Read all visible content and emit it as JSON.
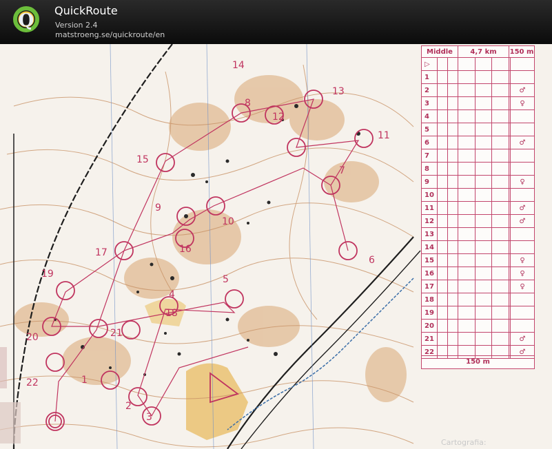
{
  "app": {
    "title": "QuickRoute",
    "version": "Version 2.4",
    "url": "matstroeng.se/quickroute/en",
    "logo_letter": "Q"
  },
  "colors": {
    "header_bg": "#111111",
    "course_magenta": "#c0345f",
    "paper": "#f7f3ee",
    "contour_brown": "#c08a60",
    "open_yellow": "#e8c270",
    "water_blue": "#3a6ea8"
  },
  "map": {
    "control_labels": [
      "14",
      "13",
      "8",
      "12",
      "15",
      "7",
      "9",
      "10",
      "16",
      "17",
      "11",
      "6",
      "19",
      "5",
      "18",
      "4",
      "20",
      "21",
      "22",
      "1",
      "2",
      "3"
    ],
    "credit": "Cartografia:"
  },
  "control_descriptions": {
    "header": {
      "event": "Middle",
      "length": "4,7 km",
      "climb": "150 m"
    },
    "rows": [
      {
        "num": "▷",
        "symbol": ""
      },
      {
        "num": "1",
        "symbol": ""
      },
      {
        "num": "2",
        "symbol": "♂"
      },
      {
        "num": "3",
        "symbol": "♀"
      },
      {
        "num": "4",
        "symbol": ""
      },
      {
        "num": "5",
        "symbol": ""
      },
      {
        "num": "6",
        "symbol": "♂"
      },
      {
        "num": "7",
        "symbol": ""
      },
      {
        "num": "8",
        "symbol": ""
      },
      {
        "num": "9",
        "symbol": "♀"
      },
      {
        "num": "10",
        "symbol": ""
      },
      {
        "num": "11",
        "symbol": "♂"
      },
      {
        "num": "12",
        "symbol": "♂"
      },
      {
        "num": "13",
        "symbol": ""
      },
      {
        "num": "14",
        "symbol": ""
      },
      {
        "num": "15",
        "symbol": "♀"
      },
      {
        "num": "16",
        "symbol": "♀"
      },
      {
        "num": "17",
        "symbol": "♀"
      },
      {
        "num": "18",
        "symbol": ""
      },
      {
        "num": "19",
        "symbol": ""
      },
      {
        "num": "20",
        "symbol": ""
      },
      {
        "num": "21",
        "symbol": "♂"
      },
      {
        "num": "22",
        "symbol": "♂"
      }
    ],
    "footer": "150 m"
  }
}
